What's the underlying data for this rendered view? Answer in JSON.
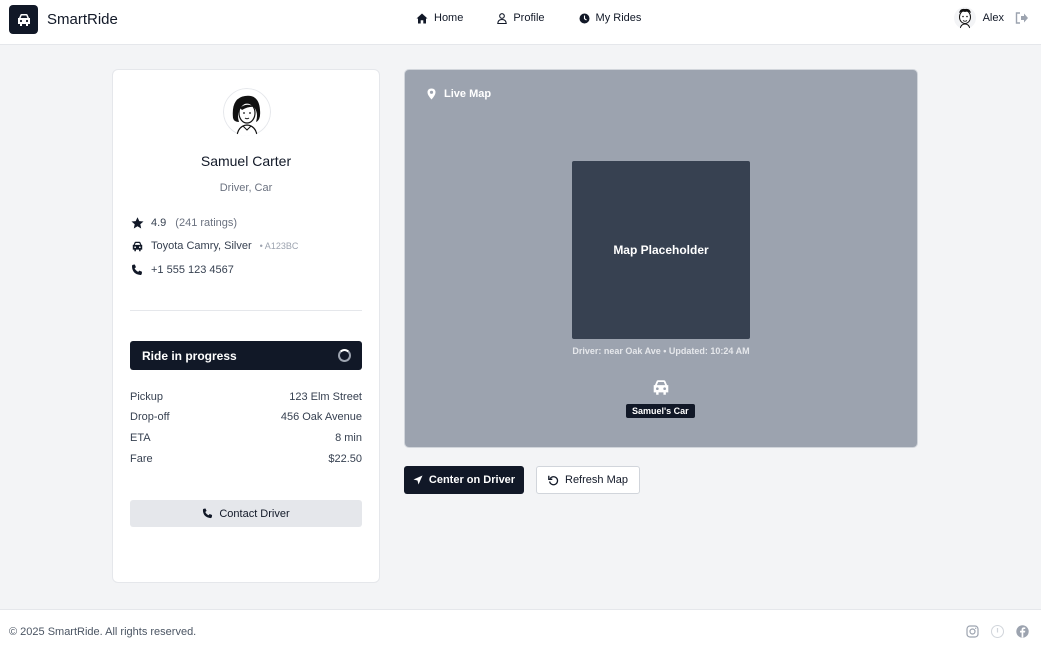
{
  "header": {
    "brand": "SmartRide",
    "nav": [
      {
        "label": "Home",
        "icon": "home-icon"
      },
      {
        "label": "Profile",
        "icon": "user-icon"
      },
      {
        "label": "My Rides",
        "icon": "clock-icon"
      }
    ],
    "user_name": "Alex"
  },
  "driver": {
    "name": "Samuel Carter",
    "role": "Driver, Car",
    "rating": "4.9",
    "ratings_count": "(241 ratings)",
    "vehicle": "Toyota Camry, Silver",
    "plate": "• A123BC",
    "phone": "+1 555 123 4567"
  },
  "ride": {
    "status": "Ride in progress",
    "details": [
      {
        "label": "Pickup",
        "value": "123 Elm Street"
      },
      {
        "label": "Drop-off",
        "value": "456 Oak Avenue"
      },
      {
        "label": "ETA",
        "value": "8 min"
      },
      {
        "label": "Fare",
        "value": "$22.50"
      }
    ],
    "contact_label": "Contact Driver"
  },
  "map": {
    "title": "Live Map",
    "placeholder": "Map Placeholder",
    "caption": "Driver: near Oak Ave • Updated: 10:24 AM",
    "car_label": "Samuel's Car"
  },
  "actions": {
    "center_label": "Center on Driver",
    "refresh_label": "Refresh Map"
  },
  "footer": {
    "copyright": "© 2025 SmartRide. All rights reserved.",
    "socials": [
      "instagram-icon",
      "twitter-icon",
      "facebook-icon"
    ]
  },
  "colors": {
    "primary": "#111827",
    "map_bg": "#9ca3af",
    "map_tile": "#374151",
    "page_bg": "#f3f4f6"
  }
}
